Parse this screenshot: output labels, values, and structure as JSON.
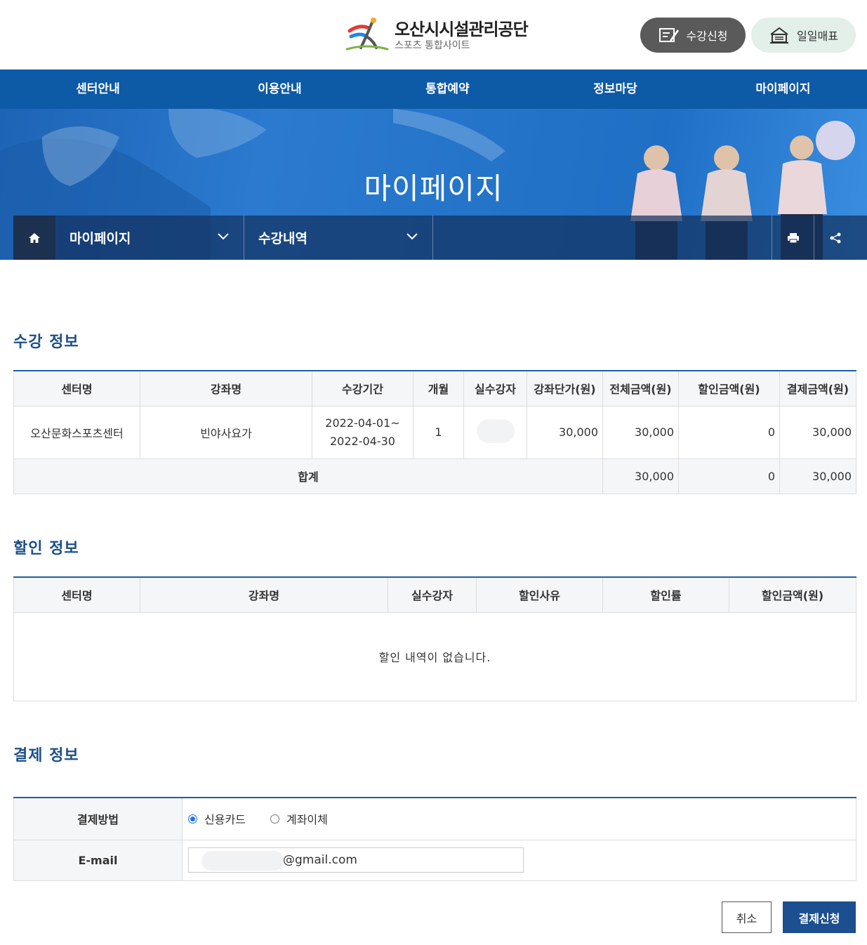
{
  "header": {
    "org_name": "오산시시설관리공단",
    "site_name": "스포츠 통합사이트",
    "enroll_button": "수강신청",
    "daily_ticket_button": "일일매표"
  },
  "nav": {
    "items": [
      "센터안내",
      "이용안내",
      "통합예약",
      "정보마당",
      "마이페이지"
    ]
  },
  "visual": {
    "title": "마이페이지"
  },
  "location": {
    "depth1": "마이페이지",
    "depth2": "수강내역"
  },
  "course_info": {
    "title": "수강 정보",
    "headers": [
      "센터명",
      "강좌명",
      "수강기간",
      "개월",
      "실수강자",
      "강좌단가(원)",
      "전체금액(원)",
      "할인금액(원)",
      "결제금액(원)"
    ],
    "row": {
      "center": "오산문화스포츠센터",
      "course": "빈야사요가",
      "period_start": "2022-04-01~",
      "period_end": "2022-04-30",
      "months": "1",
      "unit_price": "30,000",
      "total": "30,000",
      "discount": "0",
      "payment": "30,000"
    },
    "sum": {
      "label": "합계",
      "total": "30,000",
      "discount": "0",
      "payment": "30,000"
    }
  },
  "discount_info": {
    "title": "할인 정보",
    "headers": [
      "센터명",
      "강좌명",
      "실수강자",
      "할인사유",
      "할인률",
      "할인금액(원)"
    ],
    "empty_message": "할인 내역이 없습니다."
  },
  "payment_info": {
    "title": "결제 정보",
    "method_label": "결제방법",
    "method_options": [
      "신용카드",
      "계좌이체"
    ],
    "selected_method": "신용카드",
    "email_label": "E-mail",
    "email_value": "@gmail.com"
  },
  "actions": {
    "cancel": "취소",
    "submit": "결제신청"
  },
  "colors": {
    "nav_bg": "#0d5aa7",
    "section_title": "#1c4f8a",
    "submit_bg": "#1b4f90",
    "enroll_bg": "#5a5a5a",
    "daily_bg": "#e3efe9"
  }
}
